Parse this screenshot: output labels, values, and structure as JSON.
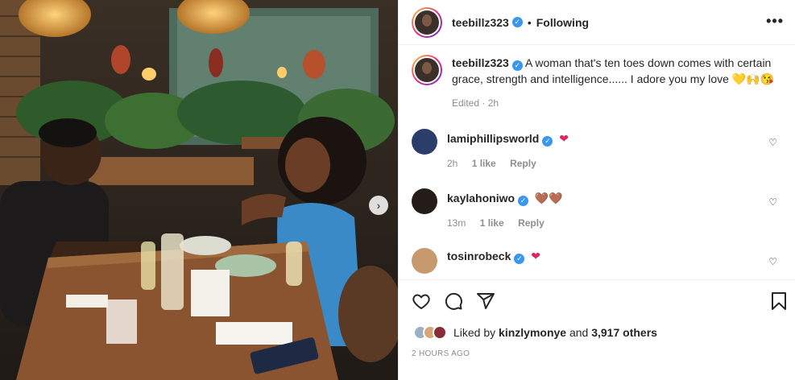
{
  "post": {
    "username": "teebillz323",
    "follow_status": "Following",
    "dot": "•",
    "more_label": "•••"
  },
  "caption": {
    "username": "teebillz323",
    "text": "A woman that's ten toes down comes with certain grace, strength and intelligence...... I adore you my love 💛🙌😘",
    "edited": "Edited · 2h"
  },
  "comments": [
    {
      "username": "lamiphillipsworld",
      "text": "❤",
      "time": "2h",
      "likes": "1 like",
      "reply": "Reply",
      "text_color": "#e0245e"
    },
    {
      "username": "kaylahoniwo",
      "text": "🤎🤎",
      "time": "13m",
      "likes": "1 like",
      "reply": "Reply",
      "text_color": "#6b4423"
    },
    {
      "username": "tosinrobeck",
      "text": "❤",
      "time": "",
      "likes": "",
      "reply": "",
      "text_color": "#e0245e"
    }
  ],
  "likes": {
    "prefix": "Liked by",
    "user": "kinzlymonye",
    "middle": "and",
    "count": "3,917 others"
  },
  "timestamp": "2 HOURS AGO",
  "colors": {
    "verified": "#3897f0",
    "border": "#efefef",
    "muted": "#8e8e8e"
  },
  "icons": [
    "heart-icon",
    "comment-icon",
    "share-icon",
    "bookmark-icon",
    "more-icon",
    "next-arrow-icon"
  ]
}
